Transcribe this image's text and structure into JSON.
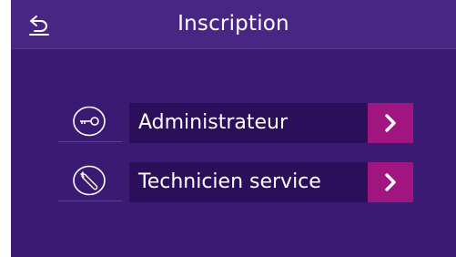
{
  "header": {
    "title": "Inscription",
    "back_icon": "back-arrow-icon"
  },
  "menu": {
    "items": [
      {
        "label": "Administrateur",
        "icon": "key-icon",
        "arrow_icon": "chevron-right-icon"
      },
      {
        "label": "Technicien service",
        "icon": "wrench-icon",
        "arrow_icon": "chevron-right-icon"
      }
    ]
  },
  "colors": {
    "background": "#3b1a74",
    "header": "#4a2684",
    "label_bg": "#2b0f5b",
    "accent": "#a0157f",
    "text": "#ffffff"
  }
}
